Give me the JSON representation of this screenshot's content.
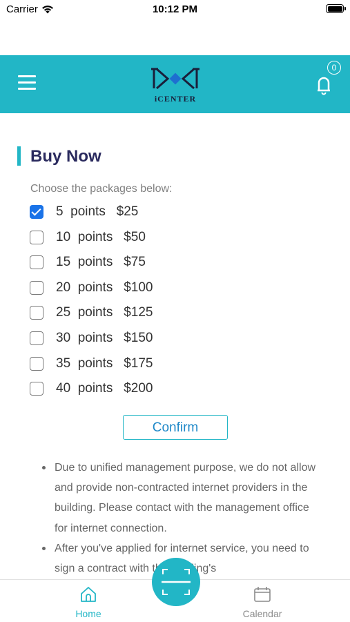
{
  "status_bar": {
    "carrier": "Carrier",
    "time": "10:12 PM"
  },
  "header": {
    "logo_text": "iCENTER",
    "notification_count": "0"
  },
  "main": {
    "title": "Buy Now",
    "instruction": "Choose the packages below:",
    "packages": [
      {
        "label": "5  points   $25",
        "checked": true
      },
      {
        "label": "10  points   $50",
        "checked": false
      },
      {
        "label": "15  points   $75",
        "checked": false
      },
      {
        "label": "20  points   $100",
        "checked": false
      },
      {
        "label": "25  points   $125",
        "checked": false
      },
      {
        "label": "30  points   $150",
        "checked": false
      },
      {
        "label": "35  points   $175",
        "checked": false
      },
      {
        "label": "40  points   $200",
        "checked": false
      }
    ],
    "confirm_label": "Confirm",
    "notes": [
      "Due to unified management purpose, we do not allow and provide non-contracted internet providers in the building. Please contact with the management office for internet connection.",
      "After you've applied for internet service, you need to sign a contract with the building's"
    ]
  },
  "tabbar": {
    "home_label": "Home",
    "calendar_label": "Calendar"
  },
  "colors": {
    "accent": "#22b6c6",
    "title": "#2a2a5e",
    "checkbox_checked": "#1a73e8"
  }
}
